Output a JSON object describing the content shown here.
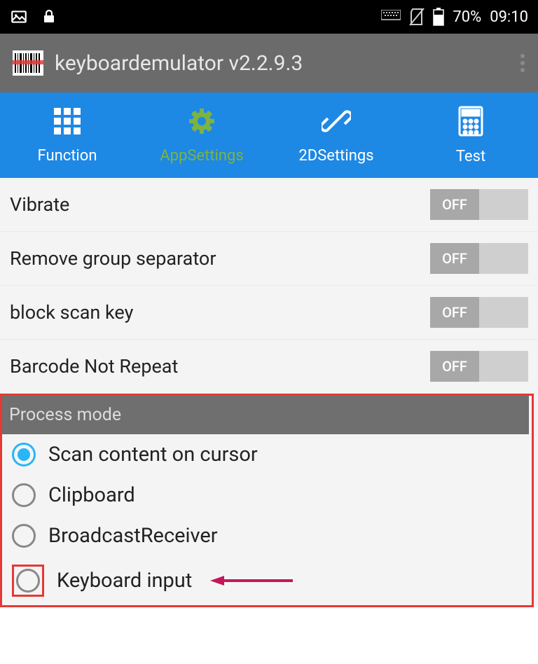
{
  "status_bar": {
    "battery_percent": "70%",
    "time": "09:10"
  },
  "app": {
    "title": "keyboardemulator v2.2.9.3"
  },
  "tabs": [
    {
      "label": "Function"
    },
    {
      "label": "AppSettings"
    },
    {
      "label": "2DSettings"
    },
    {
      "label": "Test"
    }
  ],
  "settings": [
    {
      "label": "Vibrate",
      "toggle": "OFF"
    },
    {
      "label": "Remove group separator",
      "toggle": "OFF"
    },
    {
      "label": "block scan key",
      "toggle": "OFF"
    },
    {
      "label": "Barcode Not Repeat",
      "toggle": "OFF"
    }
  ],
  "section": {
    "title": "Process mode",
    "options": [
      {
        "label": "Scan content on cursor",
        "selected": true
      },
      {
        "label": "Clipboard",
        "selected": false
      },
      {
        "label": "BroadcastReceiver",
        "selected": false
      },
      {
        "label": "Keyboard input",
        "selected": false
      }
    ]
  }
}
